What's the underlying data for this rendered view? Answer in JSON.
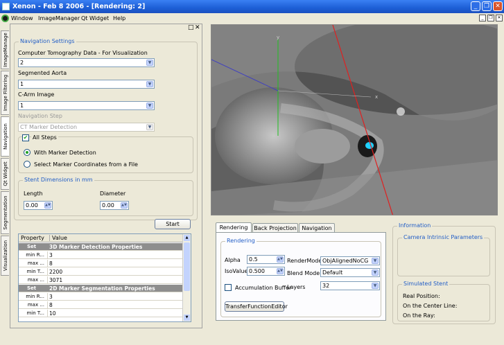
{
  "window": {
    "title": "Xenon - Feb  8 2006 - [Rendering: 2]"
  },
  "menu": [
    "Window",
    "ImageManager",
    "Qt Widget",
    "Help"
  ],
  "side_tabs": [
    "ImageManage",
    "Image Filtering",
    "Navigation",
    "Qt Widget",
    "Segmentation",
    "Visualization"
  ],
  "nav": {
    "group_title": "Navigation Settings",
    "ct_label": "Computer Tomography Data - For Visualization",
    "ct_value": "2",
    "aorta_label": "Segmented Aorta",
    "aorta_value": "1",
    "carm_label": "C-Arm Image",
    "carm_value": "1",
    "step_label": "Navigation Step",
    "step_value": "CT Marker Detection",
    "all_steps": "All Steps",
    "radio1": "With Marker Detection",
    "radio2": "Select Marker Coordinates from a File",
    "stent_title": "Stent Dimensions in mm",
    "length_label": "Length",
    "length_value": "0.00",
    "diameter_label": "Diameter",
    "diameter_value": "0.00",
    "start": "Start"
  },
  "table": {
    "headers": [
      "Property",
      "Value"
    ],
    "rows": [
      {
        "p": "Set",
        "v": "3D Marker Detection Properties",
        "section": true
      },
      {
        "p": "min R...",
        "v": "3"
      },
      {
        "p": "max ...",
        "v": "8"
      },
      {
        "p": "min T...",
        "v": "2200"
      },
      {
        "p": "max ...",
        "v": "3071"
      },
      {
        "p": "Set",
        "v": "2D Marker Segmentation Properties",
        "section": true
      },
      {
        "p": "min R...",
        "v": "3"
      },
      {
        "p": "max ...",
        "v": "8"
      },
      {
        "p": "min T...",
        "v": "10"
      }
    ]
  },
  "render": {
    "tabs": [
      "Rendering",
      "Back Projection",
      "Navigation"
    ],
    "group_title": "Rendering",
    "alpha_label": "Alpha",
    "alpha_value": "0.5",
    "iso_label": "IsoValue",
    "iso_value": "0.500",
    "rendermode_label": "RenderMode",
    "rendermode_value": "ObjAlignedNoCG",
    "blend_label": "Blend Mode",
    "blend_value": "Default",
    "accum_label": "Accumulation Buffer",
    "layers_label": "Layers",
    "layers_value": "32",
    "tf_button": "TransferFunctionEditor"
  },
  "info": {
    "title": "Information",
    "camera": "Camera Intrinsic Parameters",
    "stent": "Simulated Stent",
    "real_pos": "Real Position:",
    "center_line": "On the Center Line:",
    "ray": "On the Ray:"
  },
  "viewport_axes": {
    "y": "y",
    "x": "x"
  },
  "colors": {
    "axis_red": "#e02020",
    "axis_green": "#20c020",
    "axis_blue": "#4040c0",
    "marker": "#20d0ff"
  }
}
